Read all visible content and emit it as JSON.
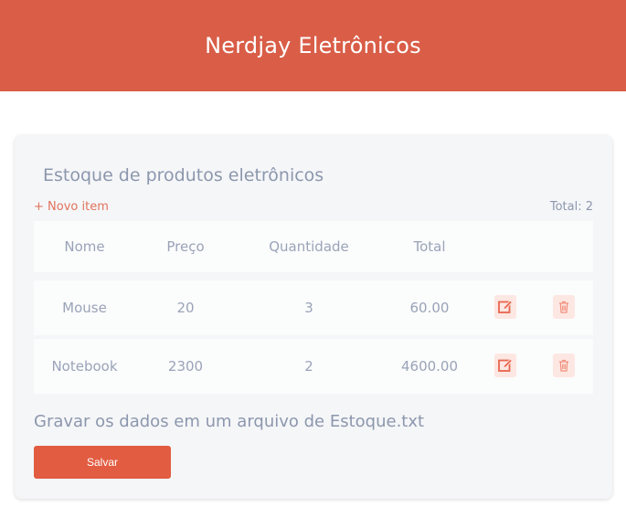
{
  "header": {
    "title": "Nerdjay Eletrônicos"
  },
  "inventory": {
    "title": "Estoque de produtos eletrônicos",
    "new_item_label": "+ Novo item",
    "total_label": "Total: 2",
    "columns": [
      "Nome",
      "Preço",
      "Quantidade",
      "Total"
    ],
    "rows": [
      {
        "nome": "Mouse",
        "preco": "20",
        "quantidade": "3",
        "total": "60.00"
      },
      {
        "nome": "Notebook",
        "preco": "2300",
        "quantidade": "2",
        "total": "4600.00"
      }
    ],
    "icons": {
      "edit": "edit-icon",
      "delete": "trash-icon"
    }
  },
  "save": {
    "caption": "Gravar os dados em um arquivo de Estoque.txt",
    "button_label": "Salvar"
  },
  "colors": {
    "brand": "#d95d47",
    "button": "#e25c41",
    "icon": "#e8654d"
  }
}
